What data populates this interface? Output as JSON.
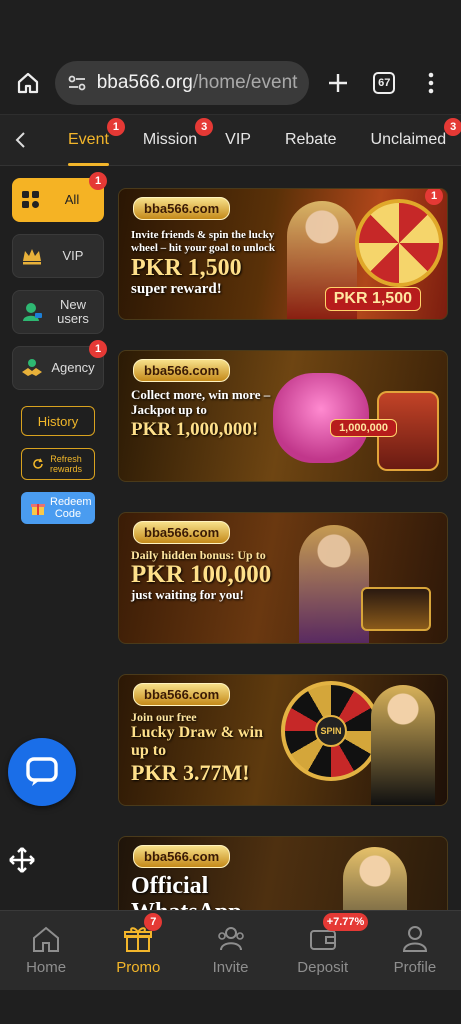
{
  "browser": {
    "url_host": "bba566.org",
    "url_path": "/home/event",
    "tab_count": "67"
  },
  "tabs": [
    {
      "label": "Event",
      "badge": "1"
    },
    {
      "label": "Mission",
      "badge": "3"
    },
    {
      "label": "VIP"
    },
    {
      "label": "Rebate"
    },
    {
      "label": "Unclaimed",
      "badge": "3"
    }
  ],
  "sidebar": {
    "items": [
      {
        "label": "All",
        "badge": "1"
      },
      {
        "label": "VIP"
      },
      {
        "label": "New users"
      },
      {
        "label": "Agency",
        "badge": "1"
      }
    ],
    "history": "History",
    "refresh": "Refresh rewards",
    "redeem": "Redeem Code"
  },
  "banners": [
    {
      "logo": "bba566.com",
      "line1": "Invite friends & spin the lucky wheel – hit your goal to unlock",
      "big": "PKR 1,500",
      "line2": "super reward!",
      "pill": "PKR 1,500",
      "badge": "1"
    },
    {
      "logo": "bba566.com",
      "line1": "Collect more, win more – Jackpot up to",
      "big": "PKR 1,000,000!",
      "pill": "1,000,000"
    },
    {
      "logo": "bba566.com",
      "line1": "Daily hidden bonus: Up to",
      "big": "PKR 100,000",
      "line2": "just waiting for you!"
    },
    {
      "logo": "bba566.com",
      "line1": "Join our free",
      "med": "Lucky Draw & win up to",
      "big": "PKR 3.77M!",
      "spin": "SPIN"
    },
    {
      "logo": "bba566.com",
      "big": "Official WhatsApp"
    }
  ],
  "bottom_nav": [
    {
      "label": "Home"
    },
    {
      "label": "Promo",
      "badge": "7"
    },
    {
      "label": "Invite"
    },
    {
      "label": "Deposit",
      "badge": "+7.77%"
    },
    {
      "label": "Profile"
    }
  ],
  "colors": {
    "accent": "#f3b62b",
    "badge": "#e53935",
    "chat": "#1a6ee8"
  }
}
